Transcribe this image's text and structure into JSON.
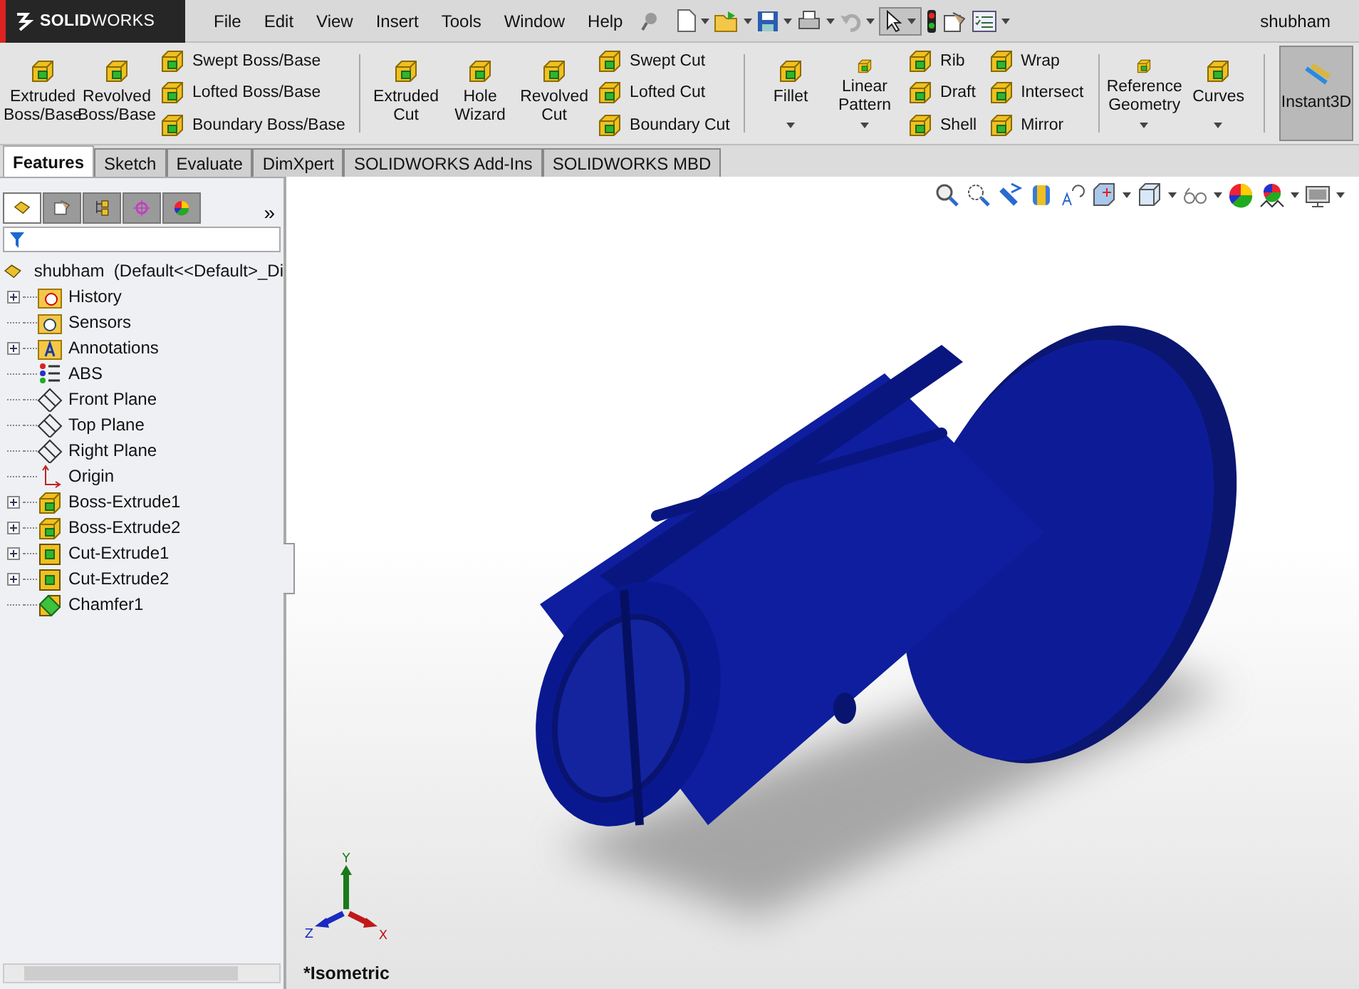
{
  "app": {
    "logo": "**SOLID**WORKS",
    "user": "shubham"
  },
  "menu": [
    "File",
    "Edit",
    "View",
    "Insert",
    "Tools",
    "Window",
    "Help"
  ],
  "ribbon": [
    {
      "kind": "large",
      "label": "Extruded Boss/Base",
      "dropdown": false,
      "selected": false
    },
    {
      "kind": "large",
      "label": "Revolved Boss/Base",
      "dropdown": false,
      "selected": false
    },
    {
      "kind": "stack",
      "items": [
        "Swept Boss/Base",
        "Lofted Boss/Base",
        "Boundary Boss/Base"
      ]
    },
    {
      "kind": "separator"
    },
    {
      "kind": "large",
      "label": "Extruded Cut",
      "dropdown": false,
      "selected": false
    },
    {
      "kind": "large",
      "label": "Hole Wizard",
      "dropdown": false,
      "selected": false
    },
    {
      "kind": "large",
      "label": "Revolved Cut",
      "dropdown": false,
      "selected": false
    },
    {
      "kind": "stack",
      "items": [
        "Swept Cut",
        "Lofted Cut",
        "Boundary Cut"
      ]
    },
    {
      "kind": "separator"
    },
    {
      "kind": "large",
      "label": "Fillet",
      "dropdown": true,
      "selected": false
    },
    {
      "kind": "large",
      "label": "Linear Pattern",
      "dropdown": true,
      "selected": false
    },
    {
      "kind": "stack",
      "items": [
        "Rib",
        "Draft",
        "Shell"
      ]
    },
    {
      "kind": "stack",
      "items": [
        "Wrap",
        "Intersect",
        "Mirror"
      ]
    },
    {
      "kind": "separator"
    },
    {
      "kind": "large",
      "label": "Reference Geometry",
      "dropdown": true,
      "selected": false
    },
    {
      "kind": "large",
      "label": "Curves",
      "dropdown": true,
      "selected": false
    },
    {
      "kind": "separator"
    },
    {
      "kind": "large",
      "label": "Instant3D",
      "dropdown": false,
      "selected": true
    }
  ],
  "tabs": [
    {
      "label": "Features",
      "selected": true
    },
    {
      "label": "Sketch",
      "selected": false
    },
    {
      "label": "Evaluate",
      "selected": false
    },
    {
      "label": "DimXpert",
      "selected": false
    },
    {
      "label": "SOLIDWORKS Add-Ins",
      "selected": false
    },
    {
      "label": "SOLIDWORKS MBD",
      "selected": false
    }
  ],
  "panel_tabs": [
    {
      "selected": true
    },
    {
      "selected": false
    },
    {
      "selected": false
    },
    {
      "selected": false
    },
    {
      "selected": false
    }
  ],
  "panel_more": "»",
  "tree": {
    "label": "shubham  (Default<<Default>_Di",
    "children": [
      {
        "label": "History",
        "kind": "history",
        "expandable": true
      },
      {
        "label": "Sensors",
        "kind": "sensors",
        "expandable": false
      },
      {
        "label": "Annotations",
        "kind": "annotations",
        "expandable": true
      },
      {
        "label": "ABS",
        "kind": "material",
        "expandable": false
      },
      {
        "label": "Front Plane",
        "kind": "plane",
        "expandable": false
      },
      {
        "label": "Top Plane",
        "kind": "plane",
        "expandable": false
      },
      {
        "label": "Right Plane",
        "kind": "plane",
        "expandable": false
      },
      {
        "label": "Origin",
        "kind": "origin",
        "expandable": false
      },
      {
        "label": "Boss-Extrude1",
        "kind": "boss",
        "expandable": true
      },
      {
        "label": "Boss-Extrude2",
        "kind": "boss",
        "expandable": true
      },
      {
        "label": "Cut-Extrude1",
        "kind": "cut",
        "expandable": true
      },
      {
        "label": "Cut-Extrude2",
        "kind": "cut",
        "expandable": true
      },
      {
        "label": "Chamfer1",
        "kind": "chamfer",
        "expandable": false
      }
    ]
  },
  "viewport": {
    "view_name": "*Isometric",
    "triad": {
      "x": "X",
      "y": "Y",
      "z": "Z"
    }
  }
}
